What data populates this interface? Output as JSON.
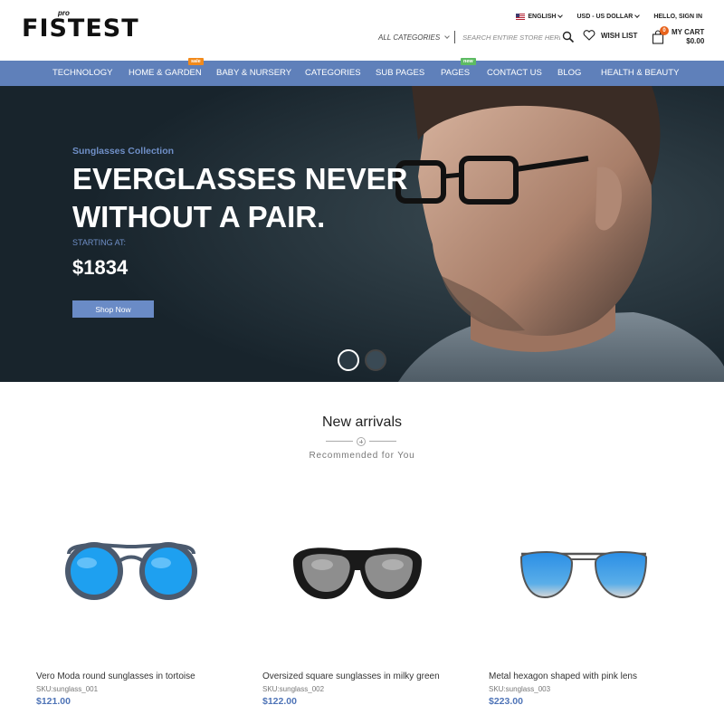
{
  "brand": {
    "logo_text": "FISTEST",
    "logo_superscript": "pro"
  },
  "top_bar": {
    "language": "ENGLISH",
    "currency": "USD - US DOLLAR",
    "account": "HELLO, SIGN IN"
  },
  "search": {
    "category_label": "ALL CATEGORIES",
    "placeholder": "SEARCH ENTIRE STORE HERE"
  },
  "wishlist": {
    "label": "WISH LIST"
  },
  "cart": {
    "label": "MY CART",
    "total": "$0.00",
    "count": "0"
  },
  "nav": {
    "items": [
      {
        "label": "TECHNOLOGY"
      },
      {
        "label": "HOME & GARDEN",
        "badge": "sale"
      },
      {
        "label": "BABY & NURSERY"
      },
      {
        "label": "CATEGORIES"
      },
      {
        "label": "SUB PAGES"
      },
      {
        "label": "PAGES",
        "badge": "new"
      },
      {
        "label": "CONTACT US"
      },
      {
        "label": "BLOG"
      },
      {
        "label": "HEALTH & BEAUTY"
      }
    ]
  },
  "hero": {
    "subtitle": "Sunglasses Collection",
    "title": "EVERGLASSES NEVER WITHOUT A PAIR.",
    "starting_label": "STARTING AT:",
    "price": "$1834",
    "button": "Shop Now"
  },
  "arrivals": {
    "title": "New arrivals",
    "subtitle": "Recommended for You",
    "products": [
      {
        "name": "Vero Moda round sunglasses in tortoise",
        "sku": "SKU:sunglass_001",
        "price": "$121.00",
        "lens_color": "#1ea0f0",
        "frame_color": "#4b5a6e"
      },
      {
        "name": "Oversized square sunglasses in milky green",
        "sku": "SKU:sunglass_002",
        "price": "$122.00",
        "lens_color": "#8e8e8e",
        "frame_color": "#1a1a1a"
      },
      {
        "name": "Metal hexagon shaped with pink lens",
        "sku": "SKU:sunglass_003",
        "price": "$223.00",
        "lens_color": "#2a8ee6",
        "frame_color": "#555555"
      }
    ]
  },
  "colors": {
    "nav_bg": "#5f80ba",
    "accent": "#6a8bc6",
    "price": "#4f74b7",
    "hero_bg": "#1d2a33",
    "badge_sale": "#f28a1b",
    "badge_new": "#5dbb63",
    "cart_badge": "#e8631c"
  },
  "icons": {
    "flag": "us-flag-icon",
    "search": "search-icon",
    "wishlist": "heart-icon",
    "cart": "shopping-bag-icon",
    "divider": "plus-circle-icon"
  }
}
